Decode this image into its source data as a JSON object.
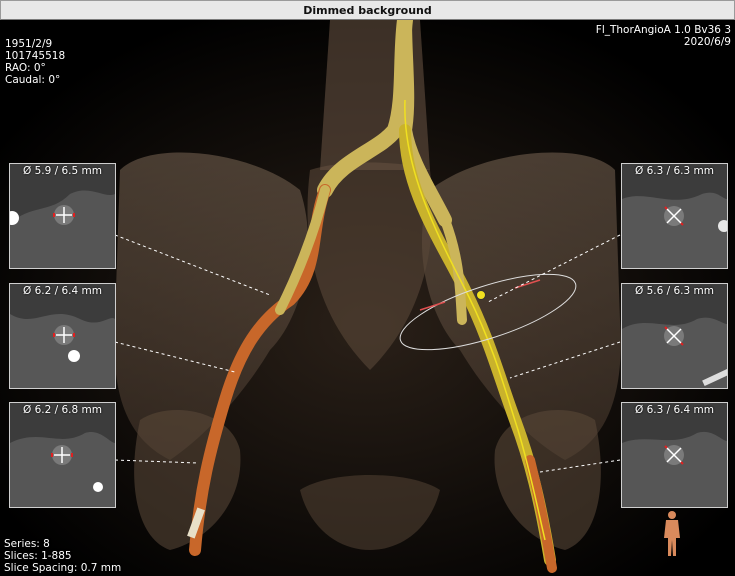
{
  "window": {
    "title": "Dimmed background"
  },
  "overlay": {
    "top_left": [
      "1951/2/9",
      "101745518",
      "RAO: 0°",
      "Caudal: 0°"
    ],
    "top_right": [
      "Fl_ThorAngioA  1.0  Bv36  3",
      "2020/6/9"
    ],
    "bottom_left": [
      "Series: 8",
      "Slices: 1-885",
      "Slice Spacing: 0.7 mm"
    ]
  },
  "cross_sections": [
    {
      "id": "right-1",
      "label": "Ø 5.9 / 6.5 mm"
    },
    {
      "id": "right-2",
      "label": "Ø 6.2 / 6.4 mm"
    },
    {
      "id": "right-3",
      "label": "Ø 6.2 / 6.8 mm"
    },
    {
      "id": "left-1",
      "label": "Ø 6.3 / 6.3 mm"
    },
    {
      "id": "left-2",
      "label": "Ø 5.6 / 6.3 mm"
    },
    {
      "id": "left-3",
      "label": "Ø 6.3 / 6.4 mm"
    }
  ],
  "colors": {
    "right_iliac": "#c8672a",
    "left_iliac": "#c9b22c",
    "centerline": "#f0e020",
    "measure_ticks": "#e02020",
    "bone": "#6e5a48"
  },
  "icons": [
    "orientation-figure-icon",
    "crosshair-icon"
  ]
}
